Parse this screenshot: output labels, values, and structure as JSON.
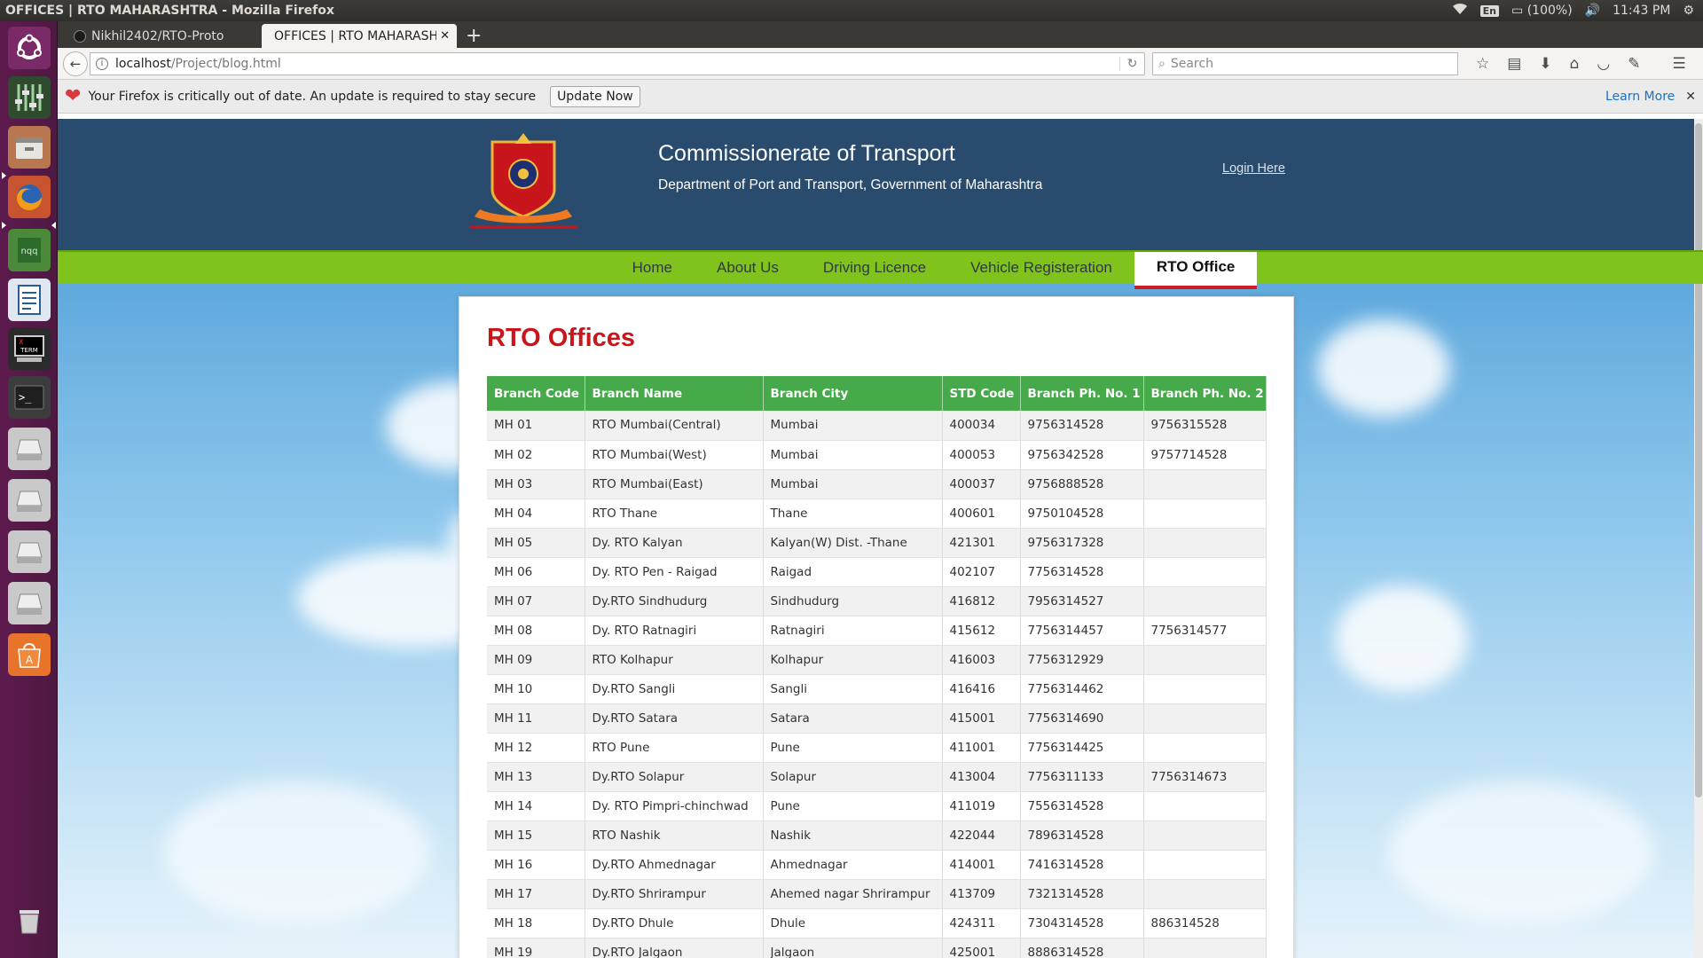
{
  "os": {
    "window_title": "OFFICES | RTO MAHARASHTRA - Mozilla Firefox",
    "battery": "(100%)",
    "keyboard": "En",
    "clock": "11:43 PM"
  },
  "launcher": {
    "items": [
      "dash-icon",
      "mixer-icon",
      "files-icon",
      "firefox-icon",
      "text-editor-icon",
      "writer-icon",
      "xterm-icon",
      "terminal-icon",
      "drive-icon",
      "drive-icon",
      "drive-icon",
      "drive-icon",
      "software-center-icon",
      "trash-icon"
    ],
    "xterm_label": "TERM"
  },
  "browser": {
    "tabs": [
      {
        "label": "Nikhil2402/RTO-Proto"
      },
      {
        "label": "OFFICES | RTO MAHARASHTRA"
      }
    ],
    "url_host": "localhost",
    "url_path": "/Project/blog.html",
    "search_placeholder": "Search",
    "notification": {
      "text": "Your Firefox is critically out of date. An update is required to stay secure",
      "button": "Update Now",
      "link": "Learn More"
    }
  },
  "site": {
    "title": "Commissionerate of Transport",
    "subtitle": "Department of Port and Transport, Government of Maharashtra",
    "login": "Login Here",
    "menu": [
      "Home",
      "About Us",
      "Driving Licence",
      "Vehicle Registeration",
      "RTO Office"
    ],
    "active_menu": "RTO Office",
    "colors": {
      "header": "#294b6d",
      "menu": "#7fc31c",
      "table_header": "#46a94a",
      "heading": "#c9161b"
    }
  },
  "content": {
    "heading": "RTO Offices",
    "columns": [
      "Branch Code",
      "Branch Name",
      "Branch City",
      "STD Code",
      "Branch Ph. No. 1",
      "Branch Ph. No. 2"
    ],
    "rows": [
      [
        "MH 01",
        "RTO Mumbai(Central)",
        "Mumbai",
        "400034",
        "9756314528",
        "9756315528"
      ],
      [
        "MH 02",
        "RTO Mumbai(West)",
        "Mumbai",
        "400053",
        "9756342528",
        "9757714528"
      ],
      [
        "MH 03",
        "RTO Mumbai(East)",
        "Mumbai",
        "400037",
        "9756888528",
        ""
      ],
      [
        "MH 04",
        "RTO Thane",
        "Thane",
        "400601",
        "9750104528",
        ""
      ],
      [
        "MH 05",
        "Dy. RTO Kalyan",
        "Kalyan(W) Dist. -Thane",
        "421301",
        "9756317328",
        ""
      ],
      [
        "MH 06",
        "Dy. RTO Pen - Raigad",
        "Raigad",
        "402107",
        "7756314528",
        ""
      ],
      [
        "MH 07",
        "Dy.RTO Sindhudurg",
        "Sindhudurg",
        "416812",
        "7956314527",
        ""
      ],
      [
        "MH 08",
        "Dy. RTO Ratnagiri",
        "Ratnagiri",
        "415612",
        "7756314457",
        "7756314577"
      ],
      [
        "MH 09",
        "RTO Kolhapur",
        "Kolhapur",
        "416003",
        "7756312929",
        ""
      ],
      [
        "MH 10",
        "Dy.RTO Sangli",
        "Sangli",
        "416416",
        "7756314462",
        ""
      ],
      [
        "MH 11",
        "Dy.RTO Satara",
        "Satara",
        "415001",
        "7756314690",
        ""
      ],
      [
        "MH 12",
        "RTO Pune",
        "Pune",
        "411001",
        "7756314425",
        ""
      ],
      [
        "MH 13",
        "Dy.RTO Solapur",
        "Solapur",
        "413004",
        "7756311133",
        "7756314673"
      ],
      [
        "MH 14",
        "Dy. RTO Pimpri-chinchwad",
        "Pune",
        "411019",
        "7556314528",
        ""
      ],
      [
        "MH 15",
        "RTO Nashik",
        "Nashik",
        "422044",
        "7896314528",
        ""
      ],
      [
        "MH 16",
        "Dy.RTO Ahmednagar",
        "Ahmednagar",
        "414001",
        "7416314528",
        ""
      ],
      [
        "MH 17",
        "Dy.RTO Shrirampur",
        "Ahemed nagar Shrirampur",
        "413709",
        "7321314528",
        ""
      ],
      [
        "MH 18",
        "Dy.RTO Dhule",
        "Dhule",
        "424311",
        "7304314528",
        "886314528"
      ],
      [
        "MH 19",
        "Dy.RTO Jalgaon",
        "Jalgaon",
        "425001",
        "8886314528",
        ""
      ]
    ]
  }
}
